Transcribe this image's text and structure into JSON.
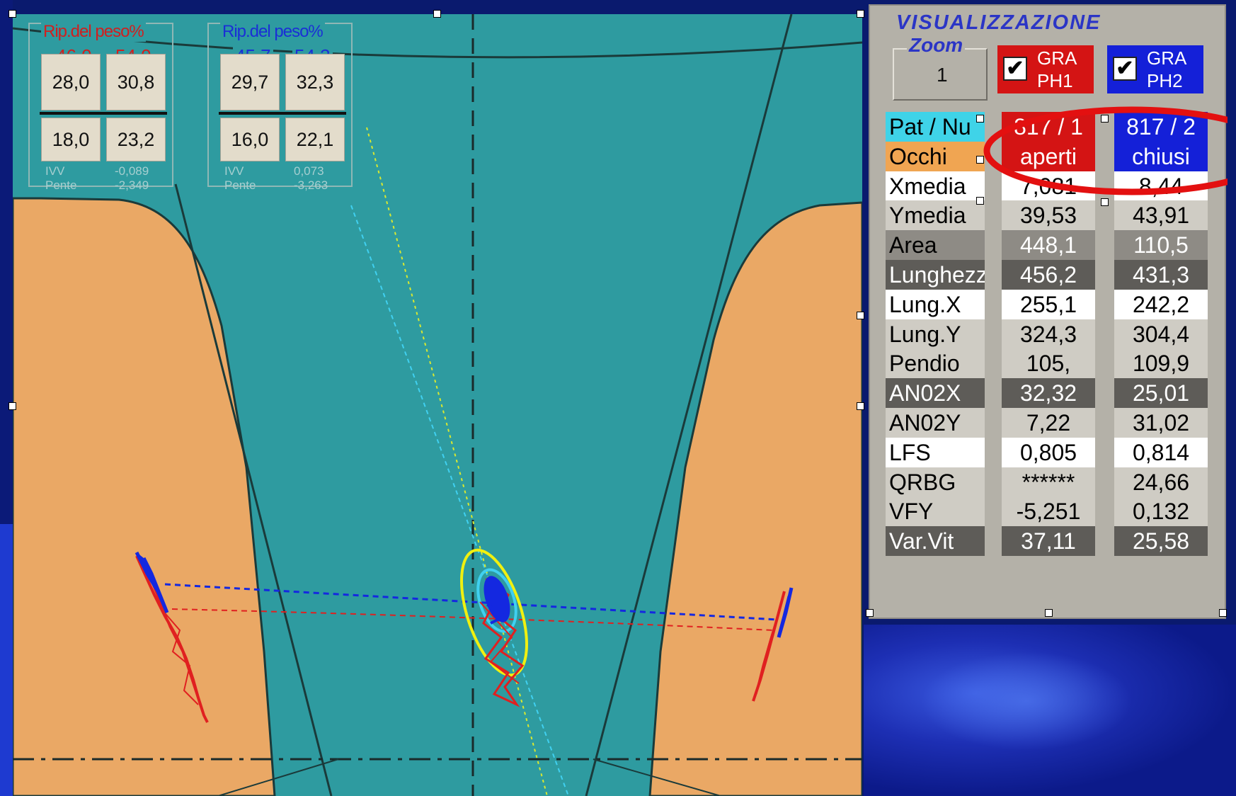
{
  "weight_box_1": {
    "title": "Rip.del peso%",
    "left_pct": "46,0",
    "right_pct": "54,0",
    "top_left": "28,0",
    "top_right": "30,8",
    "bottom_left": "18,0",
    "bottom_right": "23,2",
    "ivv_label": "IVV",
    "ivv_value": "-0,089",
    "pente_label": "Pente",
    "pente_value": "-2,349",
    "title_color": "#d11f1f"
  },
  "weight_box_2": {
    "title": "Rip.del peso%",
    "left_pct": "45,7",
    "right_pct": "54,3",
    "top_left": "29,7",
    "top_right": "32,3",
    "bottom_left": "16,0",
    "bottom_right": "22,1",
    "ivv_label": "IVV",
    "ivv_value": "0,073",
    "pente_label": "Pente",
    "pente_value": "-3,263",
    "title_color": "#1a2fd6"
  },
  "panel": {
    "title": "VISUALIZZAZIONE",
    "zoom_label": "Zoom",
    "zoom_value": "1",
    "gra_ph1": {
      "line1": "GRA",
      "line2": "PH1",
      "checked": true,
      "color": "#d41414"
    },
    "gra_ph2": {
      "line1": "GRA",
      "line2": "PH2",
      "checked": true,
      "color": "#1420d8"
    },
    "check_mark": "✔",
    "rows": [
      {
        "label": "Pat / Nu",
        "v1": "817 / 1",
        "v2": "817 / 2",
        "style": "header"
      },
      {
        "label": "Occhi",
        "v1": "aperti",
        "v2": "chiusi",
        "style": "occhi"
      },
      {
        "label": "Xmedia",
        "v1": "7,081",
        "v2": "8,44",
        "style": "white"
      },
      {
        "label": "Ymedia",
        "v1": "39,53",
        "v2": "43,91",
        "style": "light"
      },
      {
        "label": "Area",
        "v1": "448,1",
        "v2": "110,5",
        "style": "mid"
      },
      {
        "label": "Lunghezz",
        "v1": "456,2",
        "v2": "431,3",
        "style": "dark"
      },
      {
        "label": "Lung.X",
        "v1": "255,1",
        "v2": "242,2",
        "style": "white"
      },
      {
        "label": "Lung.Y",
        "v1": "324,3",
        "v2": "304,4",
        "style": "light"
      },
      {
        "label": "Pendio",
        "v1": "105,",
        "v2": "109,9",
        "style": "light"
      },
      {
        "label": "AN02X",
        "v1": "32,32",
        "v2": "25,01",
        "style": "dark"
      },
      {
        "label": "AN02Y",
        "v1": "7,22",
        "v2": "31,02",
        "style": "light"
      },
      {
        "label": "LFS",
        "v1": "0,805",
        "v2": "0,814",
        "style": "white"
      },
      {
        "label": "QRBG",
        "v1": "******",
        "v2": "24,66",
        "style": "light"
      },
      {
        "label": "VFY",
        "v1": "-5,251",
        "v2": "0,132",
        "style": "light"
      },
      {
        "label": "Var.Vit",
        "v1": "37,11",
        "v2": "25,58",
        "style": "dark"
      }
    ]
  },
  "colors": {
    "background_teal": "#2e9ba0",
    "foot_fill": "#eaa865",
    "trace_red": "#e02020",
    "trace_blue": "#1428e0",
    "ellipse_yellow": "#f0f010",
    "ellipse_cyan": "#40d0f0",
    "highlight_circle": "#e31010",
    "pat_cyan": "#3fd3e8",
    "occhi_orange": "#f0a552",
    "panel_red": "#d41414",
    "panel_blue": "#1420d8"
  }
}
